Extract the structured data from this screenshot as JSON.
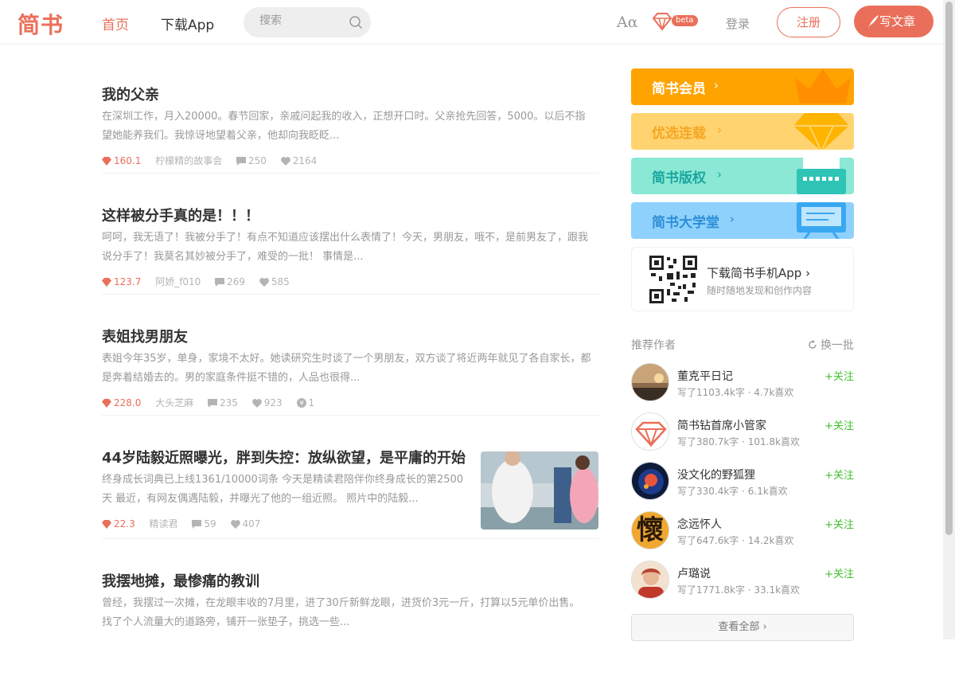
{
  "header": {
    "logo": "简书",
    "nav_home": "首页",
    "nav_app": "下载App",
    "search_placeholder": "搜索",
    "aa": "Aα",
    "beta": "beta",
    "login": "登录",
    "register": "注册",
    "write": "写文章"
  },
  "articles": [
    {
      "title": "我的父亲",
      "abstract": "在深圳工作，月入20000。春节回家，亲戚问起我的收入，正想开口时。父亲抢先回答，5000。以后不指望她能养我们。我惊讶地望着父亲，他却向我眨眨...",
      "jsd": "160.1",
      "author": "柠檬精的故事会",
      "comments": "250",
      "likes": "2164"
    },
    {
      "title": "这样被分手真的是！！！",
      "abstract": "呵呵，我无语了！我被分手了！有点不知道应该摆出什么表情了！今天，男朋友，哦不，是前男友了，跟我说分手了！我莫名其妙被分手了，难受的一批！ 事情是...",
      "jsd": "123.7",
      "author": "阿娇_f010",
      "comments": "269",
      "likes": "585"
    },
    {
      "title": "表姐找男朋友",
      "abstract": "表姐今年35岁，单身，家境不太好。她读研究生时谈了一个男朋友，双方谈了将近两年就见了各自家长，都是奔着结婚去的。男的家庭条件挺不错的，人品也很得...",
      "jsd": "228.0",
      "author": "大头芝麻",
      "comments": "235",
      "likes": "923",
      "reward": "1"
    },
    {
      "title": "44岁陆毅近照曝光，胖到失控：放纵欲望，是平庸的开始",
      "abstract": "终身成长词典已上线1361/10000词条 今天是精读君陪伴你终身成长的第2500天 最近，有网友偶遇陆毅，并曝光了他的一组近照。 照片中的陆毅...",
      "jsd": "22.3",
      "author": "精读君",
      "comments": "59",
      "likes": "407"
    },
    {
      "title": "我摆地摊，最惨痛的教训",
      "abstract": "曾经，我摆过一次摊，在龙眼丰收的7月里，进了30斤新鲜龙眼，进货价3元一斤，打算以5元单价出售。 找了个人流量大的道路旁，铺开一张垫子，挑选一些..."
    }
  ],
  "sidebar": {
    "banners": [
      "简书会员",
      "优选连载",
      "简书版权",
      "简书大学堂"
    ],
    "download_title": "下载简书手机App",
    "download_sub": "随时随地发现和创作内容",
    "rec_title": "推荐作者",
    "refresh": "换一批",
    "follow": "关注",
    "authors": [
      {
        "name": "董克平日记",
        "stats": "写了1103.4k字 · 4.7k喜欢"
      },
      {
        "name": "简书钻首席小管家",
        "stats": "写了380.7k字 · 101.8k喜欢"
      },
      {
        "name": "没文化的野狐狸",
        "stats": "写了330.4k字 · 6.1k喜欢"
      },
      {
        "name": "念远怀人",
        "stats": "写了647.6k字 · 14.2k喜欢",
        "avatar_char": "懷"
      },
      {
        "name": "卢璐说",
        "stats": "写了1771.8k字 · 33.1k喜欢"
      }
    ],
    "view_all": "查看全部"
  },
  "colors": {
    "accent": "#ea6f5a",
    "follow": "#42c02e"
  }
}
